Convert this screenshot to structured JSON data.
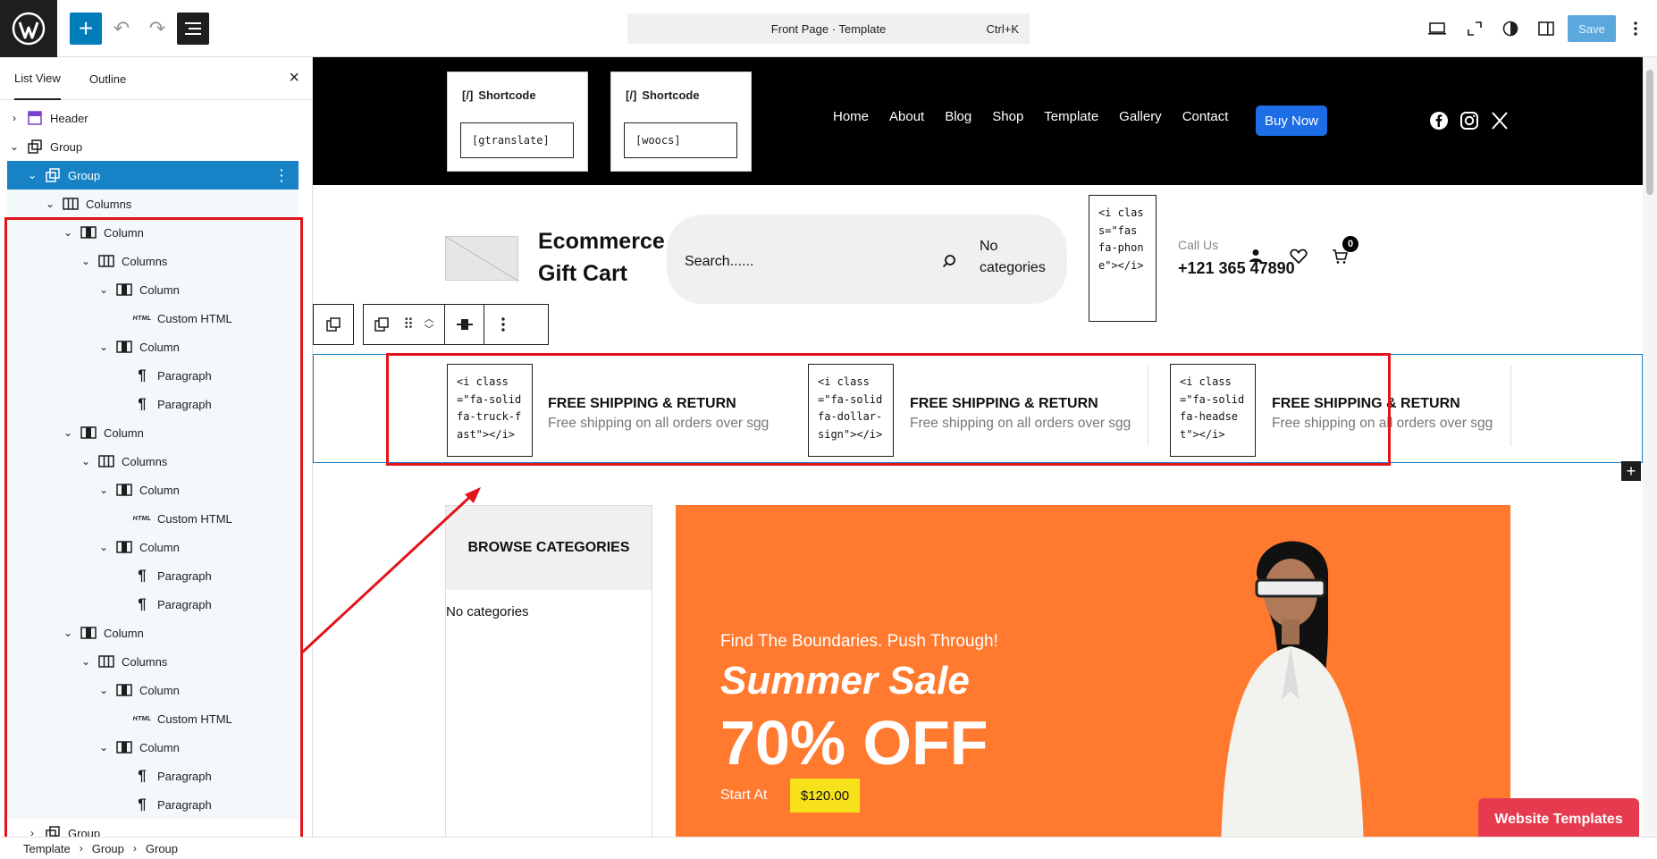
{
  "topbar": {
    "command_label": "Front Page · Template",
    "command_shortcut": "Ctrl+K",
    "save_label": "Save"
  },
  "sidebar": {
    "tabs": [
      "List View",
      "Outline"
    ],
    "tree": [
      {
        "label": "Header"
      },
      {
        "label": "Group"
      },
      {
        "label": "Group"
      },
      {
        "label": "Columns"
      },
      {
        "label": "Column"
      },
      {
        "label": "Columns"
      },
      {
        "label": "Column"
      },
      {
        "label": "Custom HTML"
      },
      {
        "label": "Column"
      },
      {
        "label": "Paragraph"
      },
      {
        "label": "Paragraph"
      },
      {
        "label": "Column"
      },
      {
        "label": "Columns"
      },
      {
        "label": "Column"
      },
      {
        "label": "Custom HTML"
      },
      {
        "label": "Column"
      },
      {
        "label": "Paragraph"
      },
      {
        "label": "Paragraph"
      },
      {
        "label": "Column"
      },
      {
        "label": "Columns"
      },
      {
        "label": "Column"
      },
      {
        "label": "Custom HTML"
      },
      {
        "label": "Column"
      },
      {
        "label": "Paragraph"
      },
      {
        "label": "Paragraph"
      },
      {
        "label": "Group"
      }
    ]
  },
  "canvas": {
    "shortcodes": [
      {
        "title": "Shortcode",
        "value": "[gtranslate]"
      },
      {
        "title": "Shortcode",
        "value": "[woocs]"
      }
    ],
    "nav": [
      "Home",
      "About",
      "Blog",
      "Shop",
      "Template",
      "Gallery",
      "Contact"
    ],
    "buy_now": "Buy Now",
    "brand": "Ecommerce Gift Cart",
    "search_placeholder": "Search......",
    "no_categories": "No categories",
    "phone_icon_html": "<i class=\"fas fa-phone\"></i>",
    "call_us": "Call Us",
    "phone": "+121 365 47890",
    "cart_count": "0",
    "features": [
      {
        "html": "<i class=\"fa-solid fa-truck-fast\"></i>",
        "title": "FREE SHIPPING & RETURN",
        "subtitle": "Free shipping on all orders over sgg"
      },
      {
        "html": "<i class=\"fa-solid fa-dollar-sign\"></i>",
        "title": "FREE SHIPPING & RETURN",
        "subtitle": "Free shipping on all orders over sgg"
      },
      {
        "html": "<i class=\"fa-solid fa-headset\"></i>",
        "title": "FREE SHIPPING & RETURN",
        "subtitle": "Free shipping on all orders over sgg"
      }
    ],
    "browse_title": "BROWSE CATEGORIES",
    "browse_empty": "No categories",
    "banner": {
      "kicker": "Find The Boundaries. Push Through!",
      "sale": "Summer Sale",
      "off": "70% OFF",
      "start_at": "Start At",
      "price": "$120.00"
    },
    "website_templates": "Website Templates"
  },
  "breadcrumb": [
    "Template",
    "Group",
    "Group"
  ],
  "colors": {
    "accent": "#007cba",
    "selection": "#1782c5",
    "annotation_red": "#e3131b",
    "banner_orange": "#ff7a2f",
    "buy_now_blue": "#1d6de5"
  }
}
